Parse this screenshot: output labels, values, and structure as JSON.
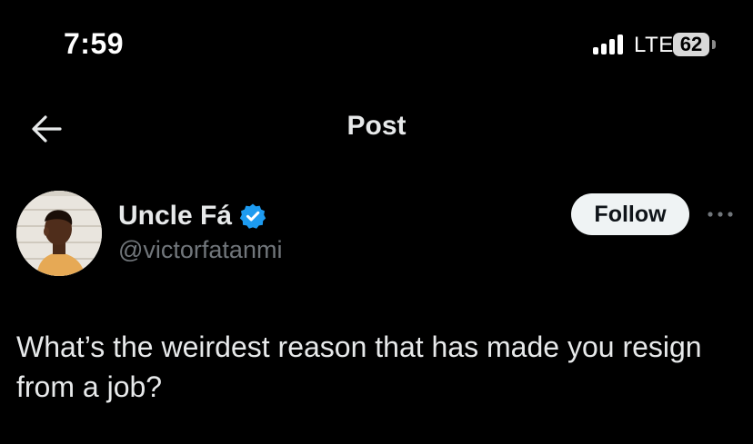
{
  "status_bar": {
    "time": "7:59",
    "network": "LTE",
    "battery": "62",
    "signal_icon": "cellular-signal-icon"
  },
  "nav": {
    "back_icon": "arrow-left-icon",
    "title": "Post"
  },
  "post": {
    "author": {
      "display_name": "Uncle Fá",
      "handle": "@victorfatanmi",
      "verified": true,
      "verified_color": "#1d9bf0"
    },
    "follow_label": "Follow",
    "more_icon": "more-horizontal-icon",
    "text": "What’s the weirdest reason that has made you resign from a job?"
  },
  "colors": {
    "background": "#000000",
    "primary_text": "#e7e9ea",
    "secondary_text": "#71767b",
    "follow_bg": "#eff3f4",
    "accent": "#1d9bf0"
  }
}
